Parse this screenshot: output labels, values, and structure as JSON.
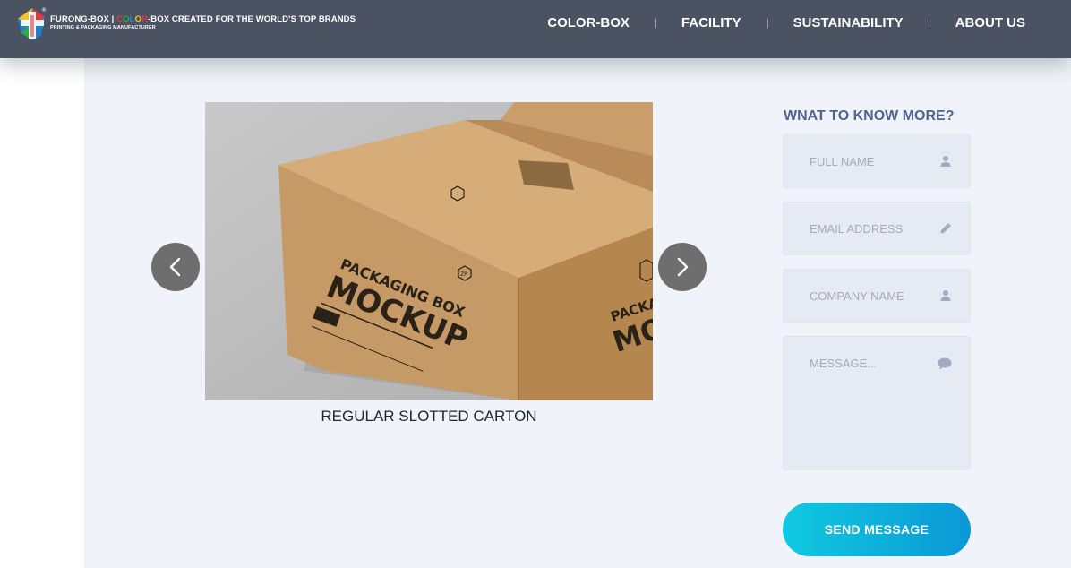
{
  "header": {
    "brand": {
      "name": "FURONG-BOX",
      "separator": "|",
      "color_word": [
        "C",
        "O",
        "L",
        "O",
        "R"
      ],
      "tagline_rest": "-BOX CREATED FOR THE WORLD'S TOP BRANDS",
      "subtitle": "PRINTING & PACKAGING MANUFACTURER",
      "registered_mark": "®"
    },
    "nav": [
      "COLOR-BOX",
      "FACILITY",
      "SUSTAINABILITY",
      "ABOUT US"
    ],
    "colors": {
      "bar": "#4b5262",
      "text": "#ffffff"
    }
  },
  "slider": {
    "image_text": {
      "front_top": "PACKAGING BOX",
      "front_main": "MOCKUP",
      "side_top": "PACKAGING",
      "side_main": "MOCKUP",
      "logo_badge": "ZP"
    },
    "caption": "REGULAR SLOTTED CARTON",
    "prev_icon": "chevron-left-icon",
    "next_icon": "chevron-right-icon"
  },
  "form": {
    "title": "WNAT TO KNOW MORE?",
    "fields": [
      {
        "placeholder": "FULL NAME",
        "icon": "user-icon"
      },
      {
        "placeholder": "EMAIL ADDRESS",
        "icon": "pencil-icon"
      },
      {
        "placeholder": "COMPANY NAME",
        "icon": "user-icon"
      },
      {
        "placeholder": "MESSAGE...",
        "icon": "comment-icon"
      }
    ],
    "submit_label": "SEND MESSAGE",
    "colors": {
      "title": "#4f6490",
      "field_bg": "#e6eaf3",
      "placeholder": "#a2abc2",
      "button_start": "#10c9e0",
      "button_end": "#0b98d6"
    }
  }
}
